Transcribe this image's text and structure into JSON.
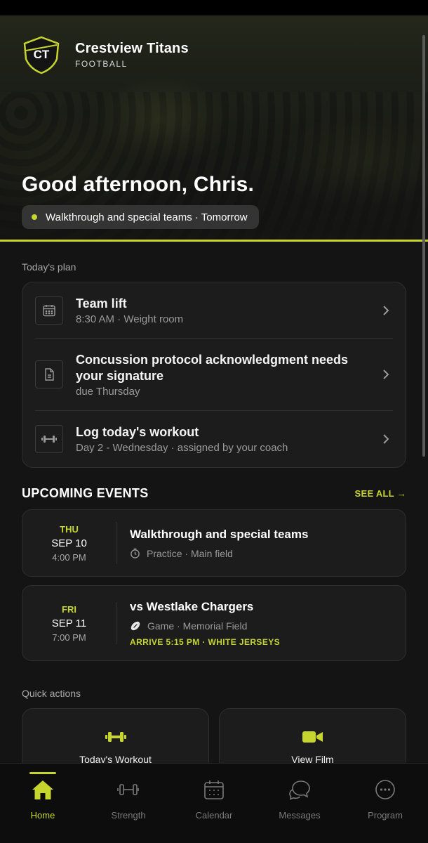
{
  "app": {
    "team_name": "Crestview Titans",
    "team_sport": "FOOTBALL",
    "logo_text": "CT",
    "accent_color": "#c6d62f"
  },
  "hero": {
    "greeting": "Good afternoon, Chris.",
    "status_text": "Walkthrough and special teams · Tomorrow"
  },
  "plan": {
    "section_label": "Today's plan",
    "items": [
      {
        "icon": "calendar-icon",
        "title": "Team lift",
        "subtitle": "8:30 AM · Weight room"
      },
      {
        "icon": "document-icon",
        "title": "Concussion protocol acknowledgment needs your signature",
        "subtitle": "due Thursday"
      },
      {
        "icon": "dumbbell-icon",
        "title": "Log today's workout",
        "subtitle": "Day 2 - Wednesday · assigned by your coach"
      }
    ]
  },
  "events": {
    "heading": "UPCOMING EVENTS",
    "see_all_label": "SEE ALL →",
    "items": [
      {
        "dow": "THU",
        "date": "SEP 10",
        "time": "4:00 PM",
        "title": "Walkthrough and special teams",
        "meta_icon": "clock-icon",
        "meta": "Practice · Main field",
        "note": ""
      },
      {
        "dow": "FRI",
        "date": "SEP 11",
        "time": "7:00 PM",
        "title": "vs Westlake Chargers",
        "meta_icon": "football-icon",
        "meta": "Game · Memorial Field",
        "note": "ARRIVE 5:15 PM · WHITE JERSEYS"
      }
    ]
  },
  "quick_actions": {
    "section_label": "Quick actions",
    "items": [
      {
        "icon": "dumbbell-icon",
        "label": "Today's Workout"
      },
      {
        "icon": "video-camera-icon",
        "label": "View Film"
      }
    ]
  },
  "tabbar": {
    "items": [
      {
        "icon": "home-icon",
        "label": "Home",
        "active": true
      },
      {
        "icon": "dumbbell-icon",
        "label": "Strength",
        "active": false
      },
      {
        "icon": "calendar-icon",
        "label": "Calendar",
        "active": false
      },
      {
        "icon": "chat-bubbles-icon",
        "label": "Messages",
        "active": false
      },
      {
        "icon": "more-circle-icon",
        "label": "Program",
        "active": false
      }
    ]
  }
}
